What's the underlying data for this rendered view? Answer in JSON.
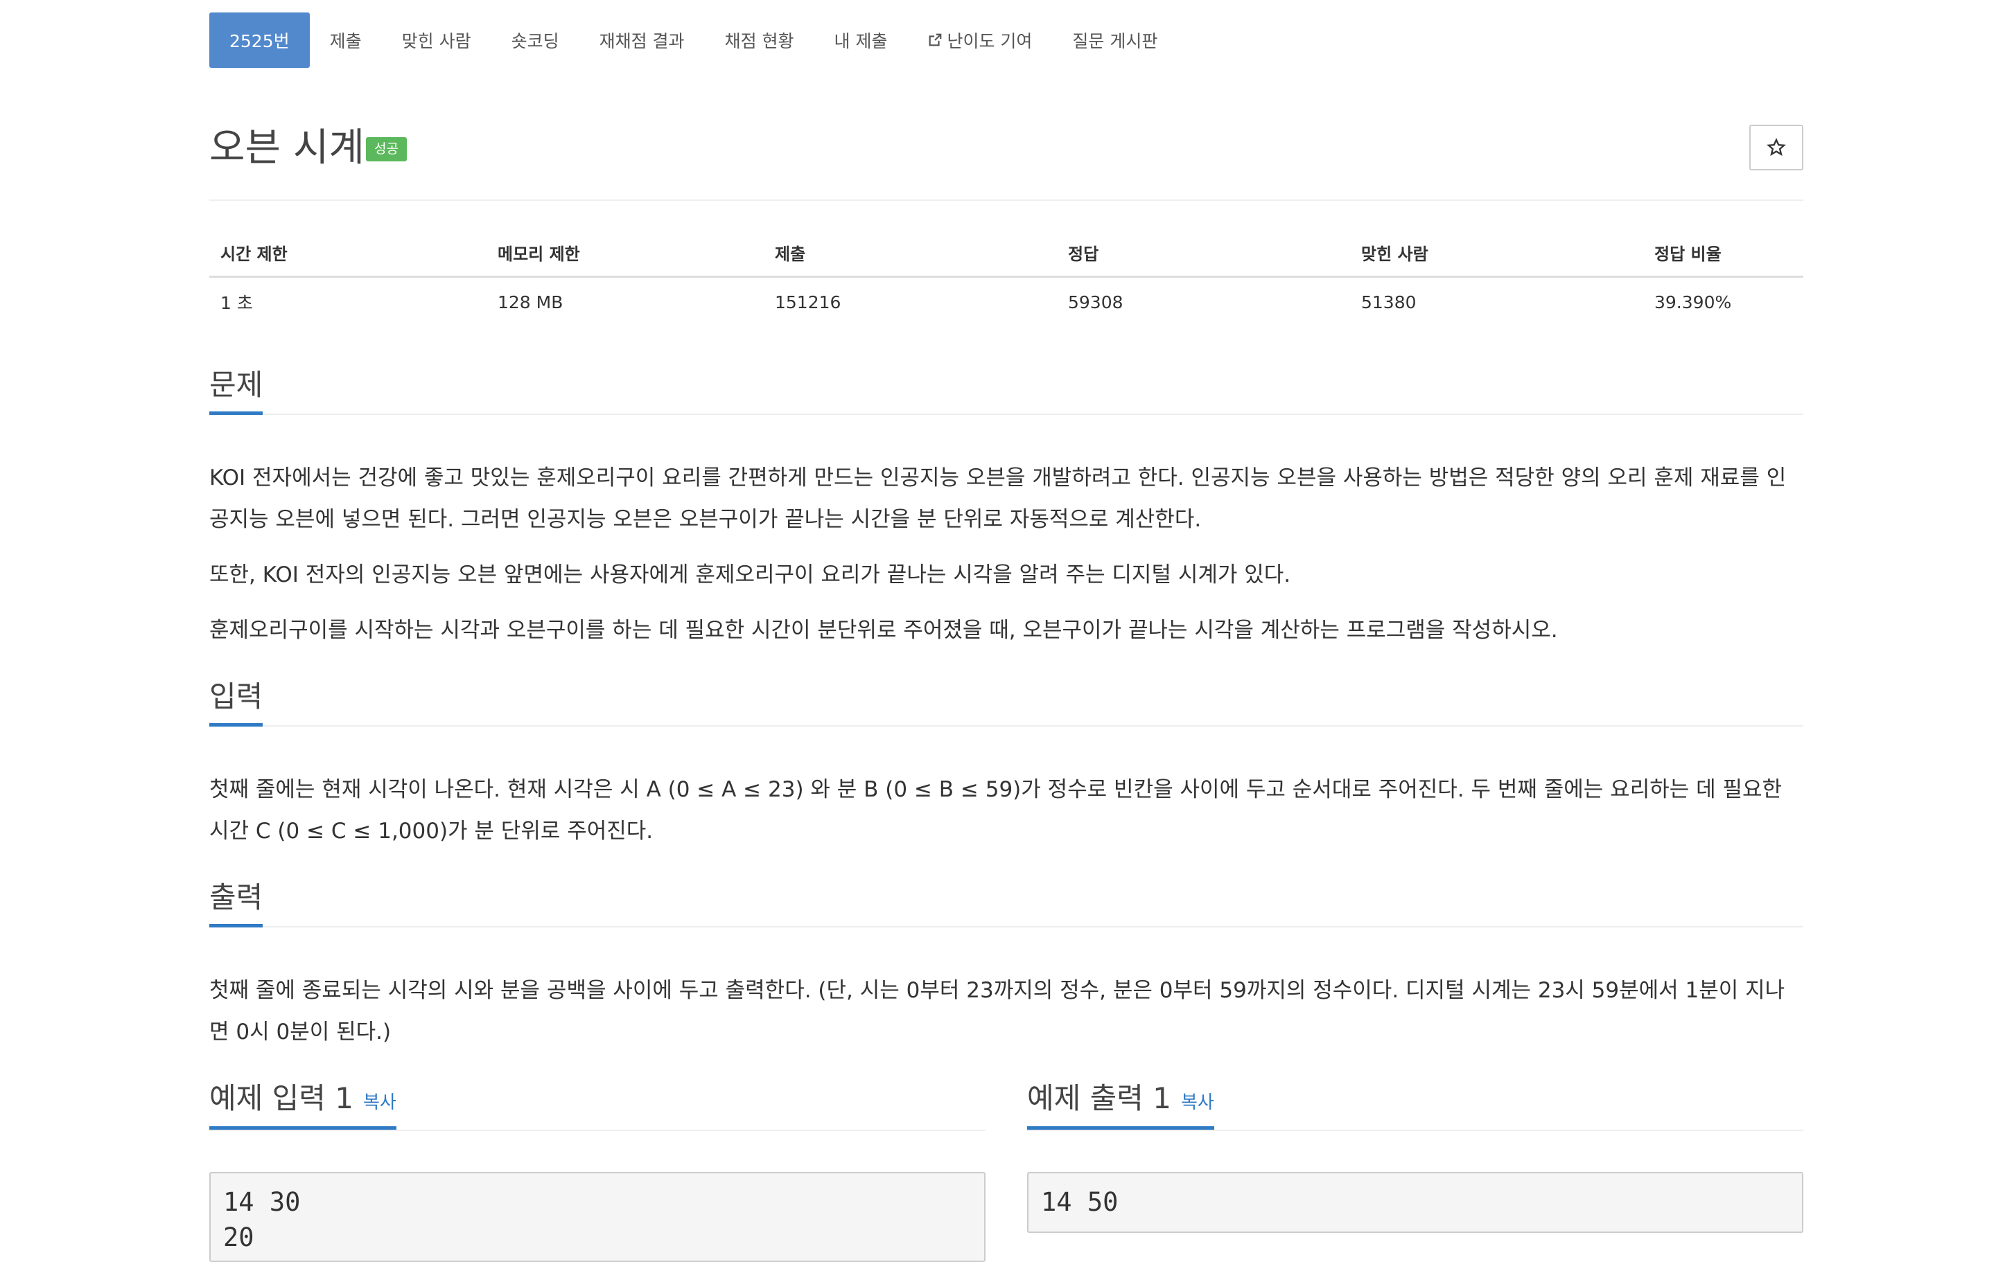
{
  "nav": {
    "tabs": [
      {
        "label": "2525번"
      },
      {
        "label": "제출"
      },
      {
        "label": "맞힌 사람"
      },
      {
        "label": "숏코딩"
      },
      {
        "label": "재채점 결과"
      },
      {
        "label": "채점 현황"
      },
      {
        "label": "내 제출"
      },
      {
        "label": "난이도 기여",
        "icon": "external-link-icon"
      },
      {
        "label": "질문 게시판"
      }
    ]
  },
  "problem": {
    "title": "오븐 시계",
    "badge": "성공",
    "badge_color": "#5cb85c",
    "star_icon": "star-outline-icon"
  },
  "info": {
    "headers": [
      "시간 제한",
      "메모리 제한",
      "제출",
      "정답",
      "맞힌 사람",
      "정답 비율"
    ],
    "values": [
      "1 초",
      "128 MB",
      "151216",
      "59308",
      "51380",
      "39.390%"
    ]
  },
  "sections": {
    "description": {
      "heading": "문제",
      "paragraphs": [
        "KOI 전자에서는 건강에 좋고 맛있는 훈제오리구이 요리를 간편하게 만드는 인공지능 오븐을 개발하려고 한다. 인공지능 오븐을 사용하는 방법은 적당한 양의 오리 훈제 재료를 인공지능 오븐에 넣으면 된다. 그러면 인공지능 오븐은 오븐구이가 끝나는 시간을 분 단위로 자동적으로 계산한다.",
        "또한, KOI 전자의 인공지능 오븐 앞면에는 사용자에게 훈제오리구이 요리가 끝나는 시각을 알려 주는 디지털 시계가 있다.",
        "훈제오리구이를 시작하는 시각과 오븐구이를 하는 데 필요한 시간이 분단위로 주어졌을 때, 오븐구이가 끝나는 시각을 계산하는 프로그램을 작성하시오."
      ]
    },
    "input": {
      "heading": "입력",
      "text": "첫째 줄에는 현재 시각이 나온다. 현재 시각은 시 A (0 ≤ A ≤ 23) 와 분 B (0 ≤ B ≤ 59)가 정수로 빈칸을 사이에 두고 순서대로 주어진다. 두 번째 줄에는 요리하는 데 필요한 시간 C (0 ≤ C ≤ 1,000)가 분 단위로 주어진다."
    },
    "output": {
      "heading": "출력",
      "text": "첫째 줄에 종료되는 시각의 시와 분을 공백을 사이에 두고 출력한다. (단, 시는 0부터 23까지의 정수, 분은 0부터 59까지의 정수이다. 디지털 시계는 23시 59분에서 1분이 지나면 0시 0분이 된다.)"
    }
  },
  "samples": {
    "input": {
      "heading": "예제 입력 1",
      "copy_label": "복사",
      "content": "14 30\n20"
    },
    "output": {
      "heading": "예제 출력 1",
      "copy_label": "복사",
      "content": "14 50"
    }
  },
  "colors": {
    "accent": "#2f7ac4",
    "active_tab": "#5289cc"
  }
}
